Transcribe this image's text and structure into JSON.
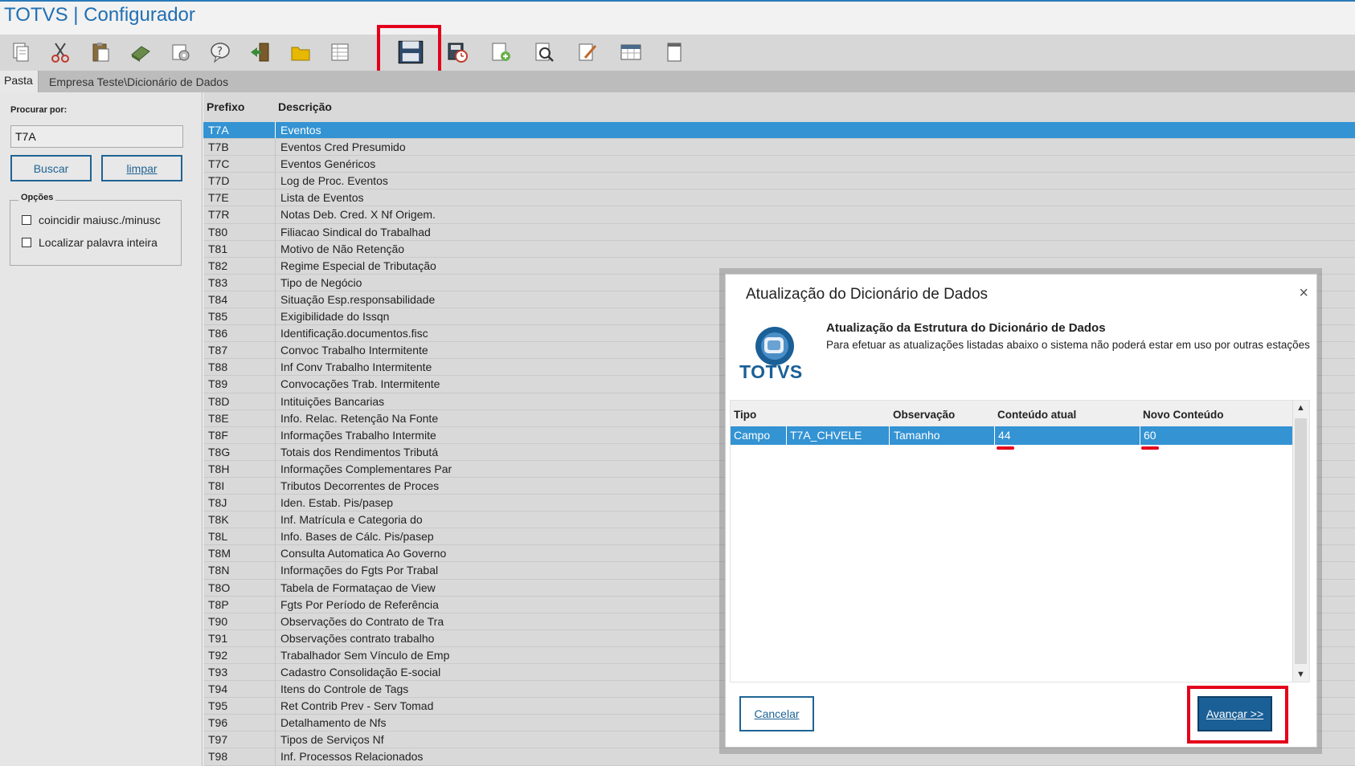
{
  "app": {
    "title": "TOTVS | Configurador"
  },
  "toolbar": {
    "buttons": [
      "copy-icon",
      "cut-icon",
      "paste-icon",
      "eraser-icon",
      "settings-icon",
      "help-icon",
      "exit-icon",
      "folder-icon",
      "table-icon",
      "save-icon",
      "schedule-icon",
      "add-document-icon",
      "preview-icon",
      "edit-icon",
      "calendar-icon",
      "document-icon"
    ]
  },
  "tabs": {
    "pasta": "Pasta",
    "path": "Empresa Teste\\Dicionário de Dados"
  },
  "search": {
    "label": "Procurar por:",
    "value": "T7A",
    "buscar": "Buscar",
    "limpar": "limpar",
    "options_title": "Opções",
    "opt1": "coincidir maiusc./minusc",
    "opt2": "Localizar palavra inteira"
  },
  "list": {
    "headers": {
      "prefixo": "Prefixo",
      "descricao": "Descrição"
    },
    "rows": [
      [
        "T7A",
        "Eventos"
      ],
      [
        "T7B",
        "Eventos Cred Presumido"
      ],
      [
        "T7C",
        "Eventos Genéricos"
      ],
      [
        "T7D",
        "Log de Proc. Eventos"
      ],
      [
        "T7E",
        "Lista de Eventos"
      ],
      [
        "T7R",
        "Notas Deb. Cred. X Nf Origem."
      ],
      [
        "T80",
        "Filiacao Sindical do Trabalhad"
      ],
      [
        "T81",
        "Motivo de Não Retenção"
      ],
      [
        "T82",
        "Regime Especial de Tributação"
      ],
      [
        "T83",
        "Tipo de Negócio"
      ],
      [
        "T84",
        "Situação Esp.responsabilidade"
      ],
      [
        "T85",
        "Exigibilidade do Issqn"
      ],
      [
        "T86",
        "Identificação.documentos.fisc"
      ],
      [
        "T87",
        "Convoc Trabalho Intermitente"
      ],
      [
        "T88",
        "Inf Conv Trabalho Intermitente"
      ],
      [
        "T89",
        "Convocações Trab. Intermitente"
      ],
      [
        "T8D",
        "Intituições Bancarias"
      ],
      [
        "T8E",
        "Info. Relac. Retenção Na Fonte"
      ],
      [
        "T8F",
        "Informações Trabalho Intermite"
      ],
      [
        "T8G",
        "Totais dos Rendimentos Tributá"
      ],
      [
        "T8H",
        "Informações Complementares Par"
      ],
      [
        "T8I",
        "Tributos Decorrentes de Proces"
      ],
      [
        "T8J",
        "Iden. Estab. Pis/pasep"
      ],
      [
        "T8K",
        "Inf. Matrícula e Categoria do"
      ],
      [
        "T8L",
        "Info. Bases de Cálc. Pis/pasep"
      ],
      [
        "T8M",
        "Consulta Automatica Ao Governo"
      ],
      [
        "T8N",
        "Informações do Fgts Por Trabal"
      ],
      [
        "T8O",
        "Tabela de Formataçao de View"
      ],
      [
        "T8P",
        "Fgts Por Período de Referência"
      ],
      [
        "T90",
        "Observações do Contrato de Tra"
      ],
      [
        "T91",
        "Observações contrato trabalho"
      ],
      [
        "T92",
        "Trabalhador Sem Vínculo de Emp"
      ],
      [
        "T93",
        "Cadastro Consolidação E-social"
      ],
      [
        "T94",
        "Itens do Controle de Tags"
      ],
      [
        "T95",
        "Ret Contrib Prev - Serv Tomad"
      ],
      [
        "T96",
        "Detalhamento de Nfs"
      ],
      [
        "T97",
        "Tipos de Serviços Nf"
      ],
      [
        "T98",
        "Inf. Processos Relacionados"
      ]
    ]
  },
  "modal": {
    "title": "Atualização do Dicionário de Dados",
    "close": "×",
    "logo_text": "TOTVS",
    "heading": "Atualização da Estrutura do Dicionário de Dados",
    "subtext": "Para efetuar as atualizações listadas abaixo o sistema não poderá estar em uso por outras estações",
    "grid": {
      "headers": {
        "tipo": "Tipo",
        "obs": "Observação",
        "atual": "Conteúdo atual",
        "novo": "Novo Conteúdo"
      },
      "row": {
        "tipo": "Campo",
        "campo": "T7A_CHVELE",
        "obs": "Tamanho",
        "atual": "44",
        "novo": "60"
      }
    },
    "cancel": "Cancelar",
    "next": "Avançar >>"
  },
  "colors": {
    "accent": "#1f6394",
    "selection": "#3393d3",
    "highlight": "#e3001b"
  }
}
